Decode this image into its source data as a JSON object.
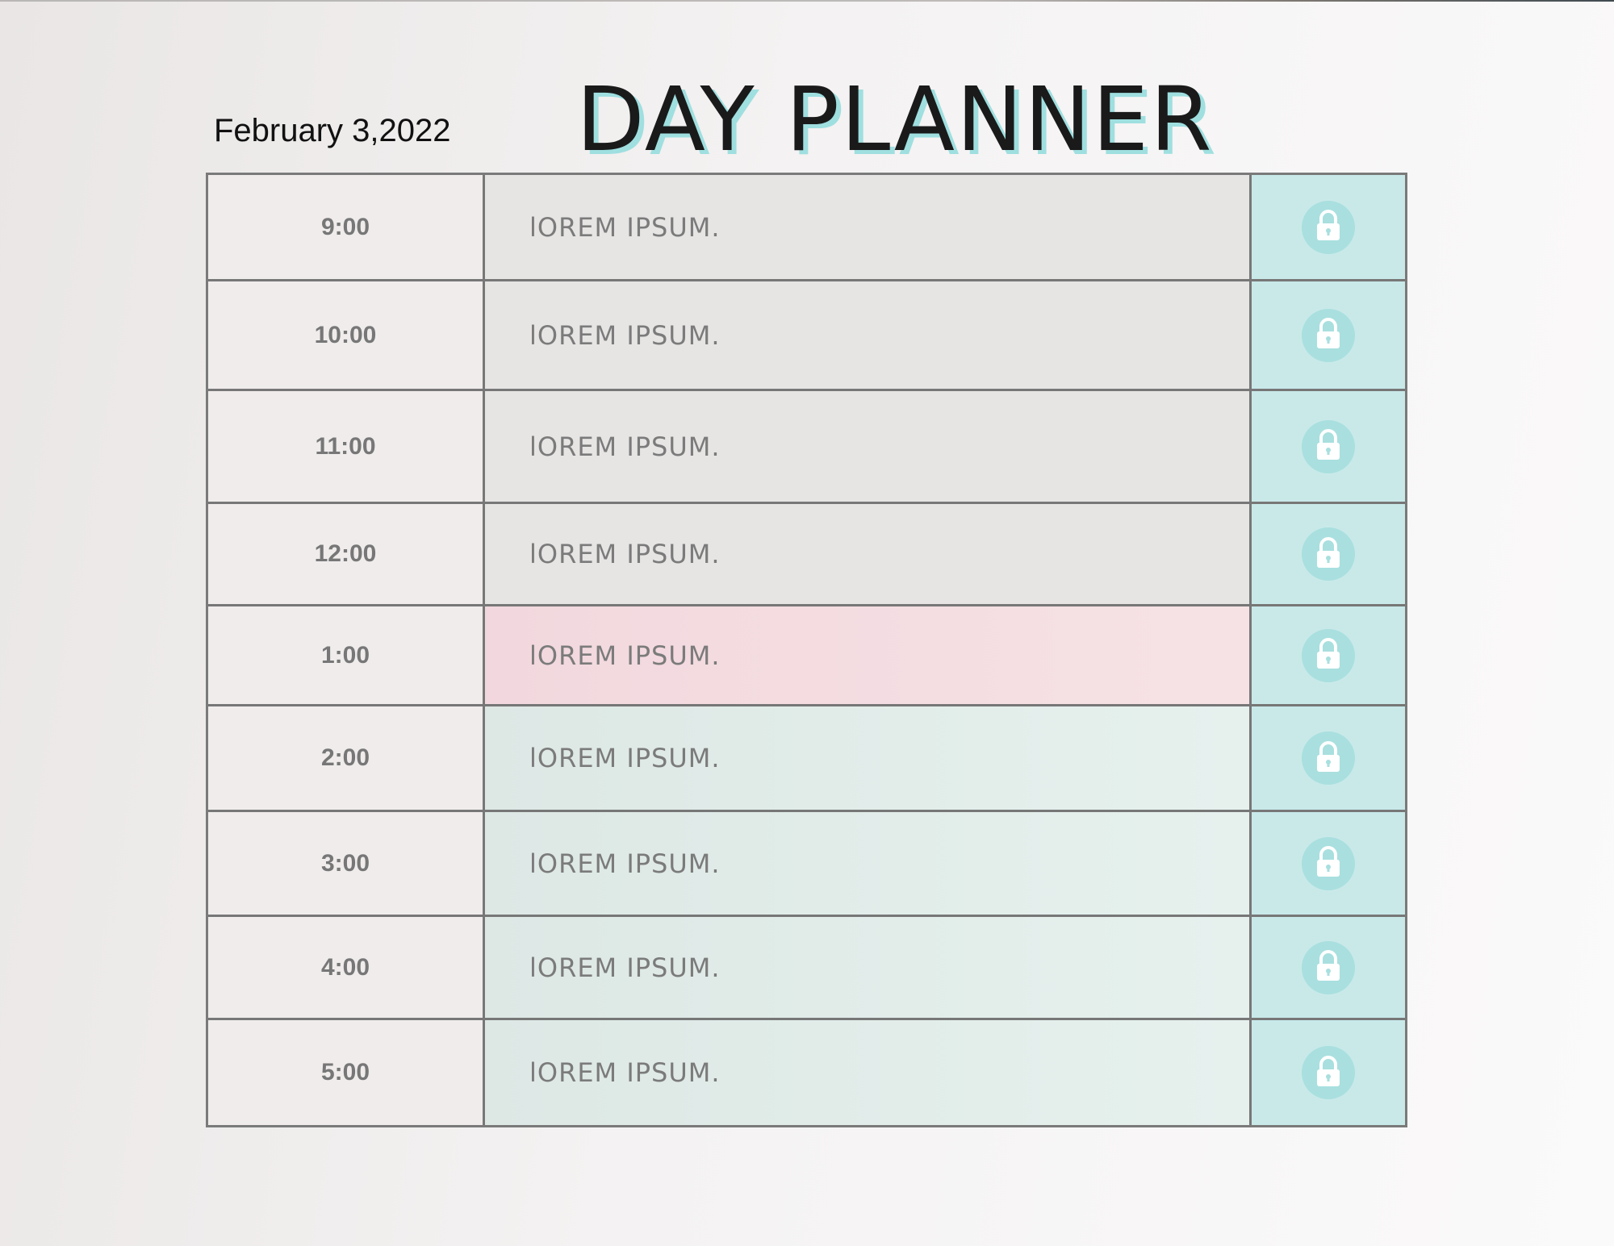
{
  "header": {
    "date": "February 3,2022",
    "title": "DAY PLANNER"
  },
  "colors": {
    "accent_teal": "#c9e9e9",
    "lock_circle": "#a9dfdf",
    "highlight_pink": "#f4dde1",
    "mint": "#e2ede9",
    "gray_cell": "#e7e5e4"
  },
  "rows": [
    {
      "time": "9:00",
      "task": "lOREM IPSUM.",
      "tone": "gray",
      "icon": "lock-icon"
    },
    {
      "time": "10:00",
      "task": "lOREM IPSUM.",
      "tone": "gray",
      "icon": "lock-icon"
    },
    {
      "time": "11:00",
      "task": "lOREM IPSUM.",
      "tone": "gray",
      "icon": "lock-icon"
    },
    {
      "time": "12:00",
      "task": "lOREM IPSUM.",
      "tone": "gray",
      "icon": "lock-icon"
    },
    {
      "time": "1:00",
      "task": "lOREM IPSUM.",
      "tone": "pink",
      "icon": "lock-icon"
    },
    {
      "time": "2:00",
      "task": "lOREM IPSUM.",
      "tone": "mint",
      "icon": "lock-icon"
    },
    {
      "time": "3:00",
      "task": "lOREM IPSUM.",
      "tone": "mint",
      "icon": "lock-icon"
    },
    {
      "time": "4:00",
      "task": "lOREM IPSUM.",
      "tone": "mint",
      "icon": "lock-icon"
    },
    {
      "time": "5:00",
      "task": "lOREM IPSUM.",
      "tone": "mint",
      "icon": "lock-icon"
    }
  ]
}
